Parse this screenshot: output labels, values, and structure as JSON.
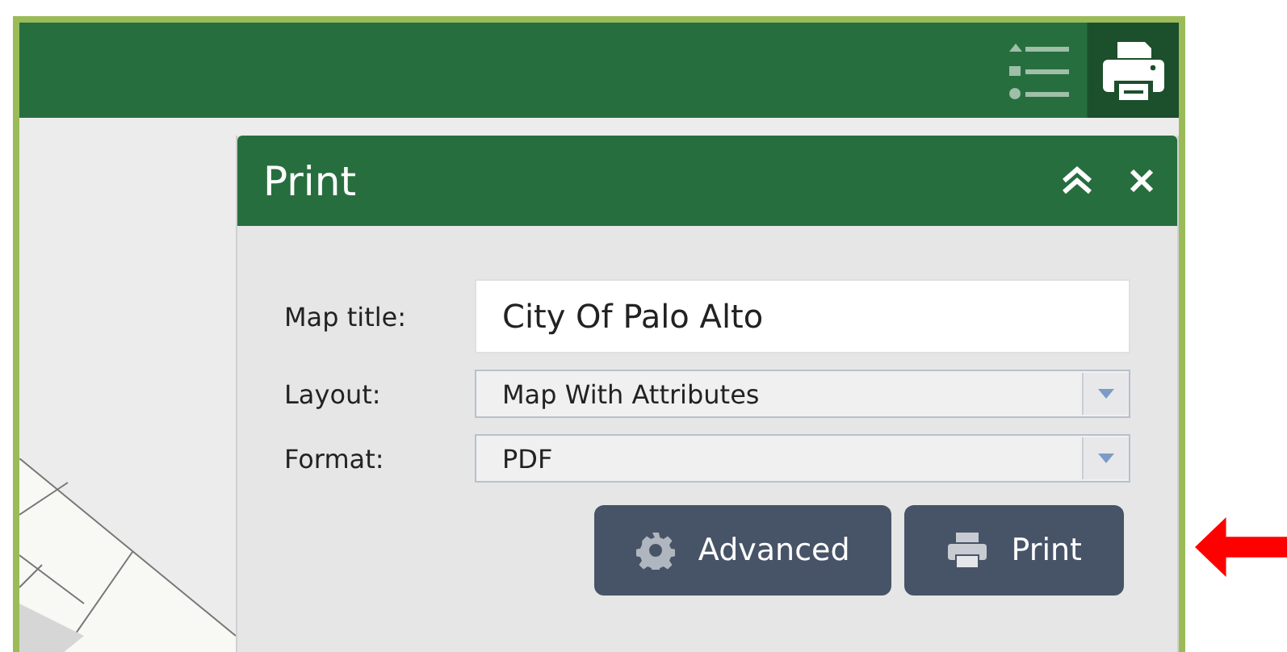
{
  "panel": {
    "title": "Print",
    "fields": [
      {
        "kind": "text",
        "label": "Map title:",
        "value": "City Of Palo Alto"
      },
      {
        "kind": "select",
        "label": "Layout:",
        "value": "Map With Attributes"
      },
      {
        "kind": "select",
        "label": "Format:",
        "value": "PDF"
      }
    ],
    "buttons": [
      {
        "kind": "advanced",
        "label": "Advanced"
      },
      {
        "kind": "print",
        "label": "Print"
      }
    ]
  }
}
